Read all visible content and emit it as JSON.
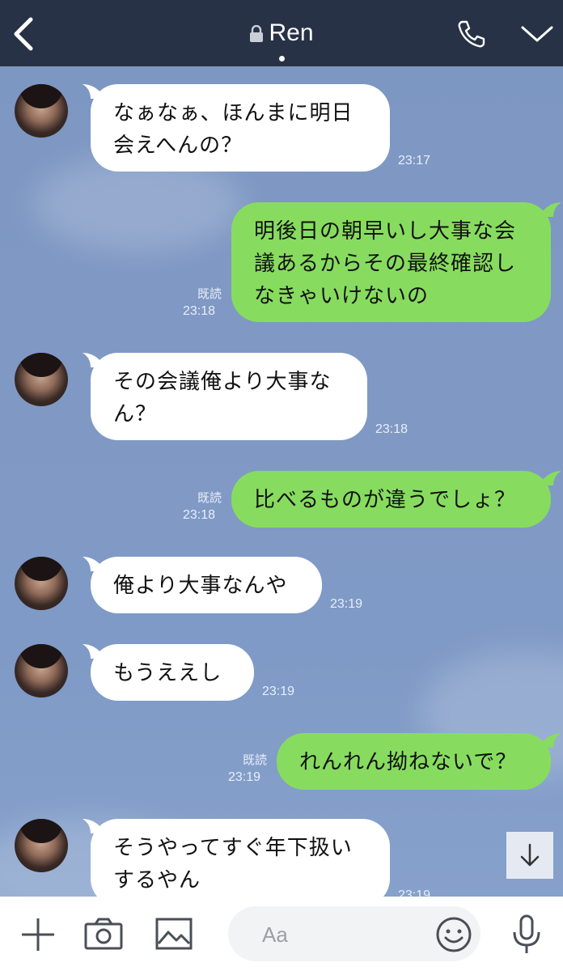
{
  "header": {
    "title": "Ren",
    "icons": {
      "back": "chevron-left-icon",
      "lock": "lock-icon",
      "call": "phone-icon",
      "menu": "chevron-down-icon"
    }
  },
  "messages": [
    {
      "side": "left",
      "lines": [
        "なぁなぁ、ほんまに明日",
        "会えへんの？"
      ],
      "time": "23:17"
    },
    {
      "side": "right",
      "lines": [
        "明後日の朝早いし大事な会",
        "議あるからその最終確認し",
        "なきゃいけないの"
      ],
      "read": "既読",
      "time": "23:18"
    },
    {
      "side": "left",
      "lines": [
        "その会議俺より大事な",
        "ん？"
      ],
      "time": "23:18"
    },
    {
      "side": "right",
      "lines": [
        "比べるものが違うでしょ？"
      ],
      "read": "既読",
      "time": "23:18"
    },
    {
      "side": "left",
      "lines": [
        "俺より大事なんや"
      ],
      "time": "23:19"
    },
    {
      "side": "left",
      "lines": [
        "もうええし"
      ],
      "time": "23:19"
    },
    {
      "side": "right",
      "lines": [
        "れんれん拗ねないで？"
      ],
      "read": "既読",
      "time": "23:19"
    },
    {
      "side": "left",
      "lines": [
        "そうやってすぐ年下扱い",
        "するやん"
      ],
      "time": "23:19"
    }
  ],
  "footer": {
    "placeholder": "Aa",
    "icons": [
      "plus-icon",
      "camera-icon",
      "image-icon",
      "emoji-icon",
      "microphone-icon"
    ]
  },
  "scroll_button": {
    "icon": "arrow-down-icon"
  },
  "colors": {
    "header_bg": "#273246",
    "chat_bg": "#7e98c4",
    "bubble_self": "#87dc5f",
    "bubble_other": "#ffffff"
  }
}
